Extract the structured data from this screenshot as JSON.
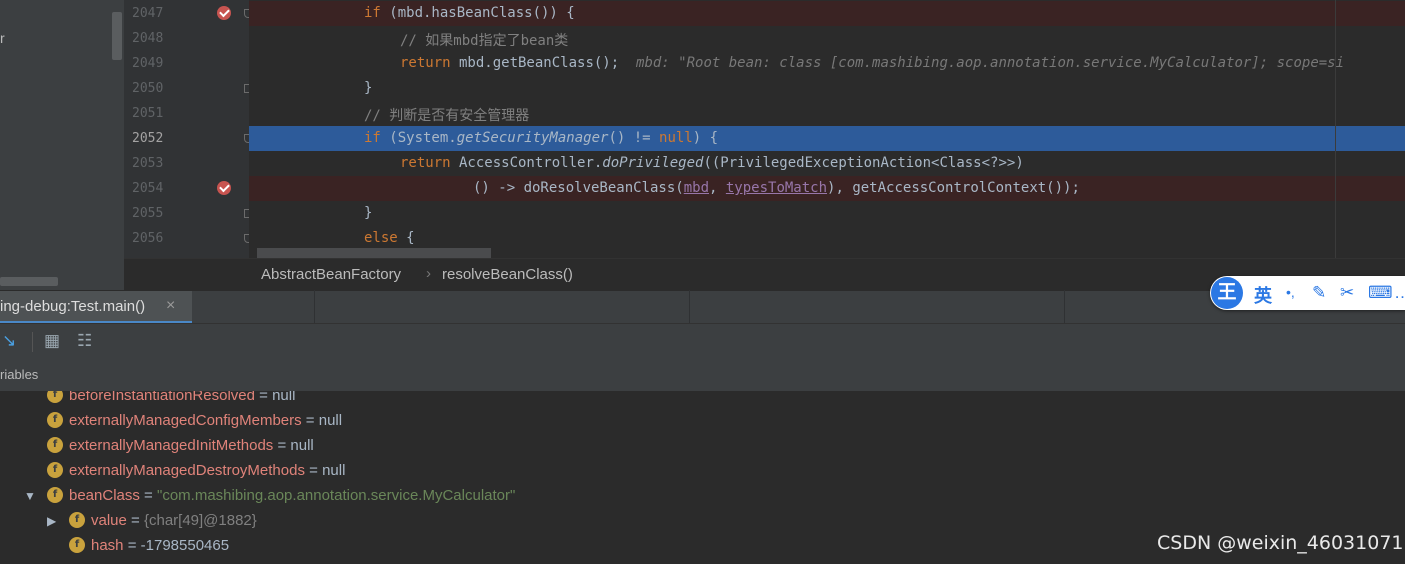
{
  "sidebar": {
    "fragment": "r"
  },
  "lines": [
    {
      "num": "2047",
      "html_parts": [
        [
          "kw",
          "if"
        ],
        [
          "",
          "(mbd.hasBeanClass()) {"
        ]
      ]
    },
    {
      "num": "2048"
    },
    {
      "num": "2049"
    },
    {
      "num": "2050"
    },
    {
      "num": "2051"
    },
    {
      "num": "2052"
    },
    {
      "num": "2053"
    },
    {
      "num": "2054"
    },
    {
      "num": "2055"
    },
    {
      "num": "2056"
    }
  ],
  "code": {
    "l2047": {
      "kw": "if",
      "rest": " (mbd.hasBeanClass()) {"
    },
    "l2048": {
      "comment": "// 如果mbd指定了bean类"
    },
    "l2049": {
      "kw": "return",
      "rest": " mbd.getBeanClass();",
      "hint": "mbd: \"Root bean: class [com.mashibing.aop.annotation.service.MyCalculator]; scope=si"
    },
    "l2050": {
      "text": "}"
    },
    "l2051": {
      "comment": "// 判断是否有安全管理器"
    },
    "l2052": {
      "kw": "if",
      "a": " (System.",
      "method": "getSecurityManager",
      "b": "() != ",
      "null": "null",
      "c": ") {"
    },
    "l2053": {
      "kw": "return",
      "a": " AccessController.",
      "method": "doPrivileged",
      "b": "((PrivilegedExceptionAction<Class<?>>)"
    },
    "l2054": {
      "a": "() -> doResolveBeanClass(",
      "p1": "mbd",
      "comma": ", ",
      "p2": "typesToMatch",
      "b": "), getAccessControlContext());"
    },
    "l2055": {
      "text": "}"
    },
    "l2056": {
      "kw": "else",
      "rest": " {"
    }
  },
  "breadcrumb": {
    "class_name": "AbstractBeanFactory",
    "separator": "›",
    "method": "resolveBeanClass()"
  },
  "debug_tab": {
    "label": "ing-debug:Test.main()",
    "close": "×"
  },
  "ime": {
    "logo": "王",
    "lang": "英",
    "dot": "•,",
    "pen": "✎",
    "scissors": "✂",
    "keyboard": "⌨",
    "more": "…"
  },
  "toolbar": {
    "step_icon": "↘",
    "table_icon": "▦",
    "split_icon": "☷"
  },
  "variables": {
    "header": "riables",
    "items": [
      {
        "name": "beforeInstantiationResolved",
        "eq": " = ",
        "value": "null",
        "kind": "plain"
      },
      {
        "name": "externallyManagedConfigMembers",
        "eq": " = ",
        "value": "null",
        "kind": "plain"
      },
      {
        "name": "externallyManagedInitMethods",
        "eq": " = ",
        "value": "null",
        "kind": "plain"
      },
      {
        "name": "externallyManagedDestroyMethods",
        "eq": " = ",
        "value": "null",
        "kind": "plain"
      },
      {
        "name": "beanClass",
        "eq": " = ",
        "value": "\"com.mashibing.aop.annotation.service.MyCalculator\"",
        "kind": "string"
      },
      {
        "name": "value",
        "eq": " = ",
        "value": "{char[49]@1882}",
        "kind": "ref"
      },
      {
        "name": "hash",
        "eq": " = ",
        "value": "-1798550465",
        "kind": "plain"
      }
    ],
    "field_badge": "f"
  },
  "watermark": "CSDN @weixin_46031071",
  "colors": {
    "keyword": "#cc7832",
    "comment": "#808080",
    "highlight": "#2d5b9a",
    "breakpoint": "#c75450",
    "string": "#6a8759",
    "field_name": "#e0837a"
  }
}
